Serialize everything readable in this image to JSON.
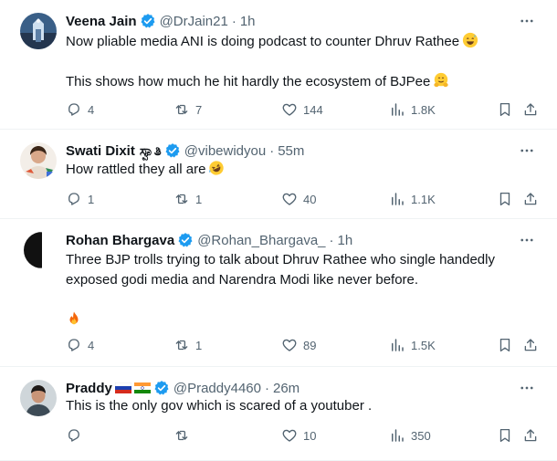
{
  "tweets": [
    {
      "name": "Veena Jain",
      "handle": "@DrJain21",
      "time": "1h",
      "lines": [
        "Now pliable media ANI is doing podcast to counter Dhruv Rathee",
        "",
        "This shows how much he hit hardly the ecosystem of BJPee"
      ],
      "emojis": [
        "grinning-sweat-emoji",
        "hugging-face-emoji"
      ],
      "replies": "4",
      "retweets": "7",
      "likes": "144",
      "views": "1.8K"
    },
    {
      "name": "Swati Dixit",
      "name_suffix": "ಸ್ವಾತಿ",
      "handle": "@vibewidyou",
      "time": "55m",
      "lines": [
        "How rattled they all are"
      ],
      "emojis": [
        "rolling-laughing-emoji"
      ],
      "replies": "1",
      "retweets": "1",
      "likes": "40",
      "views": "1.1K"
    },
    {
      "name": "Rohan Bhargava",
      "handle": "@Rohan_Bhargava_",
      "time": "1h",
      "lines": [
        "Three BJP trolls trying to talk about Dhruv Rathee who single handedly",
        "exposed godi media and Narendra Modi like never before."
      ],
      "emojis": [
        "fire-emoji"
      ],
      "replies": "4",
      "retweets": "1",
      "likes": "89",
      "views": "1.5K"
    },
    {
      "name": "Praddy",
      "flags": [
        "russia-flag",
        "india-flag"
      ],
      "handle": "@Praddy4460",
      "time": "26m",
      "lines": [
        "This is the only gov which is scared of a youtuber ."
      ],
      "replies": "",
      "retweets": "",
      "likes": "10",
      "views": "350"
    }
  ],
  "separator": "·",
  "colors": {
    "verified": "#1d9bf0",
    "muted": "#536471",
    "text": "#0f1419",
    "divider": "#eff3f4"
  }
}
